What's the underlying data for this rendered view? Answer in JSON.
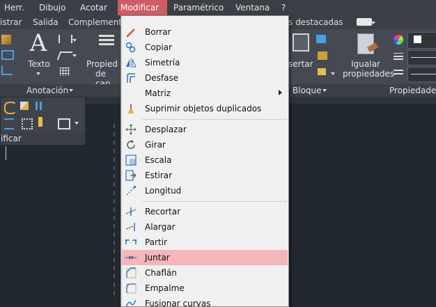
{
  "menubar": {
    "items": [
      "Herr.",
      "Dibujo",
      "Acotar",
      "Modificar",
      "Paramétrico",
      "Ventana",
      "?"
    ],
    "active": "Modificar"
  },
  "tabs": {
    "left_partial": "istrar",
    "salida": "Salida",
    "complement": "Complement",
    "destacadas": "s destacadas"
  },
  "ribbon": {
    "texto": "Texto",
    "propiedades_partial_1": "Propied",
    "propiedades_partial_2": "de cap",
    "insertar_partial": "sertar",
    "igualar_1": "Igualar",
    "igualar_2": "propiedades"
  },
  "panels": {
    "anotacion": "Anotación",
    "bloque": "Bloque",
    "propiedades": "Propiedades",
    "modificar_partial": "ificar"
  },
  "menu": {
    "items": [
      {
        "label": "Borrar",
        "icon": "eraser-icon"
      },
      {
        "label": "Copiar",
        "icon": "copy-icon"
      },
      {
        "label": "Simetría",
        "icon": "mirror-icon"
      },
      {
        "label": "Desfase",
        "icon": "offset-icon"
      },
      {
        "label": "Matriz",
        "icon": "array-icon",
        "submenu": true
      },
      {
        "label": "Suprimir objetos duplicados",
        "icon": "broom-icon"
      },
      {
        "label": "Desplazar",
        "icon": "move-icon"
      },
      {
        "label": "Girar",
        "icon": "rotate-icon"
      },
      {
        "label": "Escala",
        "icon": "scale-icon"
      },
      {
        "label": "Estirar",
        "icon": "stretch-icon"
      },
      {
        "label": "Longitud",
        "icon": "lengthen-icon"
      },
      {
        "label": "Recortar",
        "icon": "trim-icon"
      },
      {
        "label": "Alargar",
        "icon": "extend-icon"
      },
      {
        "label": "Partir",
        "icon": "break-icon"
      },
      {
        "label": "Juntar",
        "icon": "join-icon",
        "highlighted": true
      },
      {
        "label": "Chaflán",
        "icon": "chamfer-icon"
      },
      {
        "label": "Empalme",
        "icon": "fillet-icon"
      },
      {
        "label": "Fusionar curvas",
        "icon": "blend-curves-icon"
      }
    ]
  },
  "colors": {
    "menu_highlight": "#f4b6b8",
    "menubar_active": "#cf5b63",
    "canvas": "#212830"
  }
}
